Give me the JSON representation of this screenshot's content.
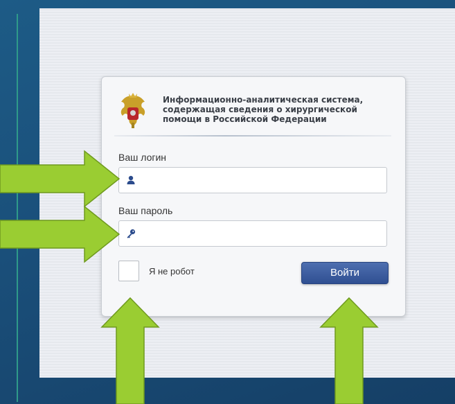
{
  "system_title_lines": [
    "Информационно-аналитическая система,",
    "содержащая сведения о хирургической",
    "помощи в Российской Федерации"
  ],
  "login": {
    "label": "Ваш логин",
    "value": "",
    "icon": "user-icon"
  },
  "password": {
    "label": "Ваш пароль",
    "value": "",
    "icon": "key-icon"
  },
  "captcha": {
    "label": "Я не робот",
    "checked": false
  },
  "submit": {
    "label": "Войти"
  },
  "colors": {
    "background": "#1a4f7a",
    "button": "#2f4f92",
    "arrow": "#9acd32",
    "icon": "#2b4b8c"
  }
}
